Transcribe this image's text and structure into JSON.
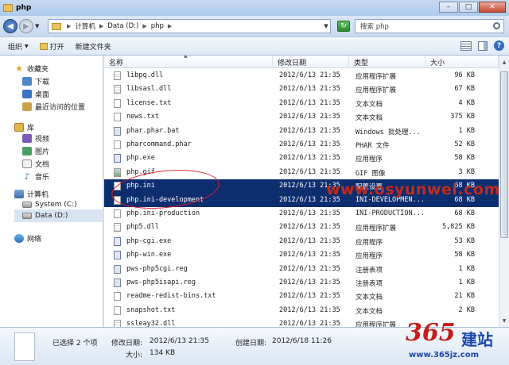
{
  "window": {
    "title": "php"
  },
  "address": {
    "segments": [
      "计算机",
      "Data (D:)",
      "php"
    ]
  },
  "search": {
    "placeholder": "搜索 php"
  },
  "toolbar": {
    "organize": "组织",
    "open": "打开",
    "new_folder": "新建文件夹"
  },
  "nav": {
    "favorites": "收藏夹",
    "downloads": "下载",
    "desktop": "桌面",
    "recent": "最近访问的位置",
    "libraries": "库",
    "videos": "视频",
    "pictures": "图片",
    "documents": "文档",
    "music": "音乐",
    "computer": "计算机",
    "system_drive": "System (C:)",
    "data_drive": "Data (D:)",
    "network": "网络"
  },
  "columns": {
    "name": "名称",
    "modified": "修改日期",
    "type": "类型",
    "size": "大小"
  },
  "files": [
    {
      "name": "libpq.dll",
      "date": "2012/6/13 21:35",
      "type": "应用程序扩展",
      "size": "96 KB",
      "icon": "dll"
    },
    {
      "name": "libsasl.dll",
      "date": "2012/6/13 21:35",
      "type": "应用程序扩展",
      "size": "67 KB",
      "icon": "dll"
    },
    {
      "name": "license.txt",
      "date": "2012/6/13 21:35",
      "type": "文本文档",
      "size": "4 KB",
      "icon": "txt"
    },
    {
      "name": "news.txt",
      "date": "2012/6/13 21:35",
      "type": "文本文档",
      "size": "375 KB",
      "icon": "txt"
    },
    {
      "name": "phar.phar.bat",
      "date": "2012/6/13 21:35",
      "type": "Windows 批处理...",
      "size": "1 KB",
      "icon": "bat"
    },
    {
      "name": "pharcommand.phar",
      "date": "2012/6/13 21:35",
      "type": "PHAR 文件",
      "size": "52 KB",
      "icon": "txt"
    },
    {
      "name": "php.exe",
      "date": "2012/6/13 21:35",
      "type": "应用程序",
      "size": "58 KB",
      "icon": "php"
    },
    {
      "name": "php.gif",
      "date": "2012/6/13 21:35",
      "type": "GIF 图像",
      "size": "3 KB",
      "icon": "gif"
    },
    {
      "name": "php.ini",
      "date": "2012/6/13 21:35",
      "type": "配置设置",
      "size": "68 KB",
      "icon": "txt",
      "selected": true
    },
    {
      "name": "php.ini-development",
      "date": "2012/6/13 21:35",
      "type": "INI-DEVELOPMEN...",
      "size": "68 KB",
      "icon": "txt",
      "selected": true
    },
    {
      "name": "php.ini-production",
      "date": "2012/6/13 21:35",
      "type": "INI-PRODUCTION...",
      "size": "68 KB",
      "icon": "txt"
    },
    {
      "name": "php5.dll",
      "date": "2012/6/13 21:35",
      "type": "应用程序扩展",
      "size": "5,825 KB",
      "icon": "dll"
    },
    {
      "name": "php-cgi.exe",
      "date": "2012/6/13 21:35",
      "type": "应用程序",
      "size": "53 KB",
      "icon": "php"
    },
    {
      "name": "php-win.exe",
      "date": "2012/6/13 21:35",
      "type": "应用程序",
      "size": "58 KB",
      "icon": "php"
    },
    {
      "name": "pws-php5cgi.reg",
      "date": "2012/6/13 21:35",
      "type": "注册表项",
      "size": "1 KB",
      "icon": "bat"
    },
    {
      "name": "pws-php5isapi.reg",
      "date": "2012/6/13 21:35",
      "type": "注册表项",
      "size": "1 KB",
      "icon": "bat"
    },
    {
      "name": "readme-redist-bins.txt",
      "date": "2012/6/13 21:35",
      "type": "文本文档",
      "size": "21 KB",
      "icon": "txt"
    },
    {
      "name": "snapshot.txt",
      "date": "2012/6/13 21:35",
      "type": "文本文档",
      "size": "2 KB",
      "icon": "txt"
    },
    {
      "name": "ssleay32.dll",
      "date": "2012/6/13 21:35",
      "type": "应用程序扩展",
      "size": "",
      "icon": "dll"
    }
  ],
  "status": {
    "selected": "已选择 2 个项",
    "modified_label": "修改日期:",
    "modified_value": "2012/6/13 21:35",
    "created_label": "创建日期:",
    "created_value": "2012/6/18 11:26",
    "size_label": "大小:",
    "size_value": "134 KB"
  },
  "watermark": {
    "url": "www.osyunwei.com",
    "logo_number": "365",
    "logo_text": "建站",
    "logo_site": "www.365jz.com"
  },
  "colors": {
    "selection": "#0c2e6e",
    "annotation": "#d8202a",
    "watermark_red": "#c22a1e",
    "logo_blue": "#1a47a8"
  }
}
